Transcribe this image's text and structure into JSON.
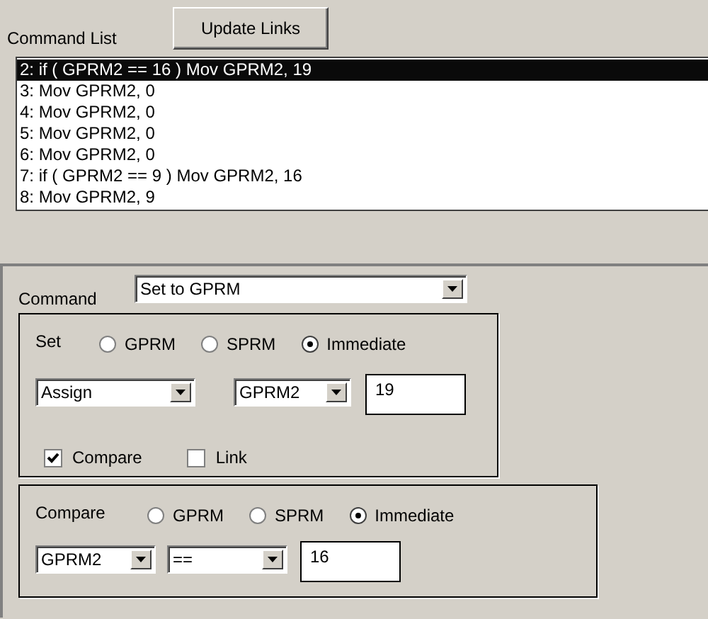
{
  "header": {
    "label": "Command List",
    "button": "Update Links"
  },
  "command_list": {
    "items": [
      {
        "text": "2: if ( GPRM2 == 16 ) Mov GPRM2, 19",
        "selected": true
      },
      {
        "text": "3: Mov GPRM2, 0",
        "selected": false
      },
      {
        "text": "4: Mov GPRM2, 0",
        "selected": false
      },
      {
        "text": "5: Mov GPRM2, 0",
        "selected": false
      },
      {
        "text": "6: Mov GPRM2, 0",
        "selected": false
      },
      {
        "text": "7: if ( GPRM2 == 9 ) Mov GPRM2, 16",
        "selected": false
      },
      {
        "text": "8: Mov GPRM2, 9",
        "selected": false
      }
    ]
  },
  "command": {
    "label": "Command",
    "value": "Set to GPRM"
  },
  "set_group": {
    "label": "Set",
    "sources": [
      {
        "label": "GPRM",
        "selected": false
      },
      {
        "label": "SPRM",
        "selected": false
      },
      {
        "label": "Immediate",
        "selected": true
      }
    ],
    "operation": "Assign",
    "register": "GPRM2",
    "value": "19",
    "options": [
      {
        "label": "Compare",
        "checked": true
      },
      {
        "label": "Link",
        "checked": false
      }
    ]
  },
  "compare_group": {
    "label": "Compare",
    "sources": [
      {
        "label": "GPRM",
        "selected": false
      },
      {
        "label": "SPRM",
        "selected": false
      },
      {
        "label": "Immediate",
        "selected": true
      }
    ],
    "register": "GPRM2",
    "operator": "==",
    "value": "16"
  }
}
